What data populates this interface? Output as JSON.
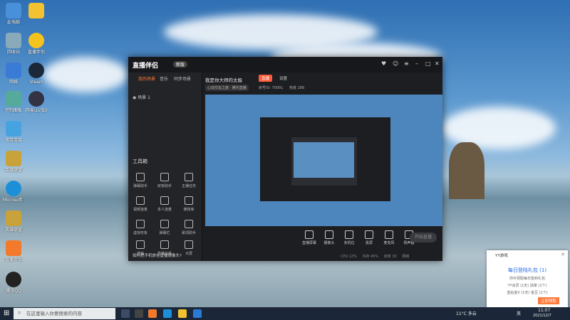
{
  "desktop": {
    "icons_col1": [
      "此电脑",
      "回收站",
      "网络",
      "控制面板",
      "宽带连接",
      "英雄联盟",
      "Microsoft Edge",
      "英雄联盟",
      "直播伴侣",
      "腾讯QQ"
    ],
    "icons_col2": [
      "",
      "直播伴侣",
      "Steam",
      "网易UU加速器"
    ]
  },
  "app": {
    "brand": "直播伴侣",
    "brand_tag": "新版",
    "tabs": [
      "我的场景",
      "音乐",
      "同步场景"
    ],
    "scene_label": "场景 1",
    "tools_title": "工具箱",
    "tools": [
      [
        "弹幕助手",
        "房管助手",
        "主播任务"
      ],
      [
        "视频连麦",
        "多人连麦",
        "媒体库"
      ],
      [
        "虚拟形象",
        "弹幕栏",
        "歌词助手"
      ],
      [
        "游戏",
        "直播分享",
        "大屏"
      ]
    ],
    "hint": "如何把手机放在直播镜像头?",
    "room_title": "我是你大师的太极",
    "room_sub": "心动交友之旅 · 娱乐直播",
    "room_meta": [
      "房号ID: 70091",
      "热度 288"
    ],
    "pill_live": "直播",
    "pill_set": "设置",
    "controls": [
      "直播屏幕",
      "摄像头",
      "多机位",
      "投屏",
      "麦克风",
      "扬声器"
    ],
    "go_live": "开始直播",
    "status": [
      "CPU 12%",
      "内存 45%",
      "帧率 30",
      "网络"
    ]
  },
  "notification": {
    "head": "YY游戏",
    "title": "每日登陆礼包 (1)",
    "line1": "你可领取每日签到礼包",
    "line2": "YY会员 (1天)  勋章 (1个)",
    "line3": "蓝钻金V (1天)  金豆 (1个)",
    "button": "立即领取"
  },
  "taskbar": {
    "search_placeholder": "在这里输入你要搜索的内容",
    "weather": "11°C 多云",
    "time": "11:07",
    "date": "2021/12/7",
    "lang": "英"
  }
}
